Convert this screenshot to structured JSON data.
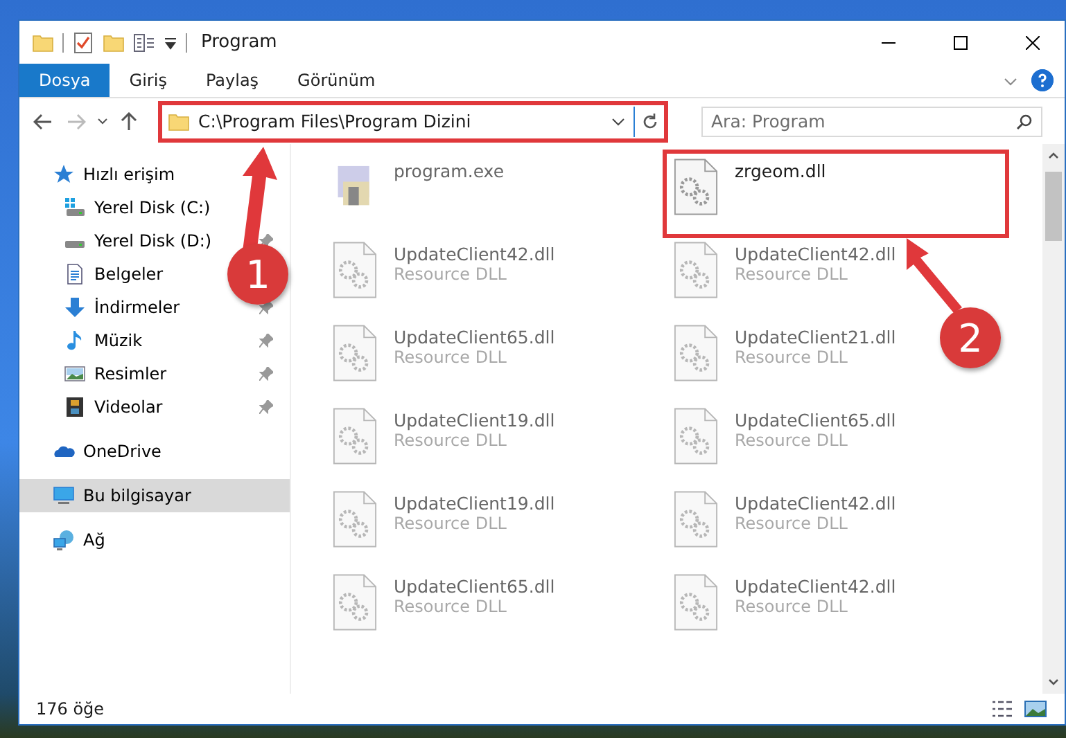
{
  "window": {
    "title": "Program"
  },
  "ribbon_tabs": [
    {
      "label": "Dosya",
      "selected": true
    },
    {
      "label": "Giriş",
      "selected": false
    },
    {
      "label": "Paylaş",
      "selected": false
    },
    {
      "label": "Görünüm",
      "selected": false
    }
  ],
  "address_bar": {
    "path": "C:\\Program Files\\Program Dizini",
    "highlighted": true
  },
  "search": {
    "placeholder": "Ara: Program"
  },
  "sidebar": {
    "items": [
      {
        "label": "Hızlı erişim",
        "kind": "star",
        "selected": false,
        "children": [
          {
            "label": "Yerel Disk (C:)",
            "kind": "drive-win",
            "pinned": false,
            "selected": false
          },
          {
            "label": "Yerel Disk (D:)",
            "kind": "drive",
            "pinned": true,
            "selected": false
          },
          {
            "label": "Belgeler",
            "kind": "docs",
            "pinned": false,
            "selected": false
          },
          {
            "label": "İndirmeler",
            "kind": "download",
            "pinned": true,
            "selected": false
          },
          {
            "label": "Müzik",
            "kind": "music",
            "pinned": true,
            "selected": false
          },
          {
            "label": "Resimler",
            "kind": "pictures",
            "pinned": true,
            "selected": false
          },
          {
            "label": "Videolar",
            "kind": "videos",
            "pinned": true,
            "selected": false
          }
        ]
      },
      {
        "label": "OneDrive",
        "kind": "cloud",
        "selected": false
      },
      {
        "label": "Bu bilgisayar",
        "kind": "computer",
        "selected": true
      },
      {
        "label": "Ağ",
        "kind": "network",
        "selected": false
      }
    ]
  },
  "files": [
    {
      "name": "program.exe",
      "kind": "exe",
      "blurred": true,
      "highlighted": false
    },
    {
      "name": "zrgeom.dll",
      "kind": "dll",
      "blurred": false,
      "highlighted": true
    },
    {
      "name": "UpdateClient42.dll",
      "type": "Resource DLL",
      "kind": "dll",
      "blurred": true,
      "highlighted": false
    },
    {
      "name": "UpdateClient42.dll",
      "type": "Resource DLL",
      "kind": "dll",
      "blurred": true,
      "highlighted": false
    },
    {
      "name": "UpdateClient65.dll",
      "type": "Resource DLL",
      "kind": "dll",
      "blurred": true,
      "highlighted": false
    },
    {
      "name": "UpdateClient21.dll",
      "type": "Resource DLL",
      "kind": "dll",
      "blurred": true,
      "highlighted": false
    },
    {
      "name": "UpdateClient19.dll",
      "type": "Resource DLL",
      "kind": "dll",
      "blurred": true,
      "highlighted": false
    },
    {
      "name": "UpdateClient65.dll",
      "type": "Resource DLL",
      "kind": "dll",
      "blurred": true,
      "highlighted": false
    },
    {
      "name": "UpdateClient19.dll",
      "type": "Resource DLL",
      "kind": "dll",
      "blurred": true,
      "highlighted": false
    },
    {
      "name": "UpdateClient42.dll",
      "type": "Resource DLL",
      "kind": "dll",
      "blurred": true,
      "highlighted": false
    },
    {
      "name": "UpdateClient65.dll",
      "type": "Resource DLL",
      "kind": "dll",
      "blurred": true,
      "highlighted": false
    },
    {
      "name": "UpdateClient42.dll",
      "type": "Resource DLL",
      "kind": "dll",
      "blurred": true,
      "highlighted": false
    }
  ],
  "status_bar": {
    "count": "176 öğe"
  },
  "callouts": [
    {
      "label": "1"
    },
    {
      "label": "2"
    }
  ]
}
